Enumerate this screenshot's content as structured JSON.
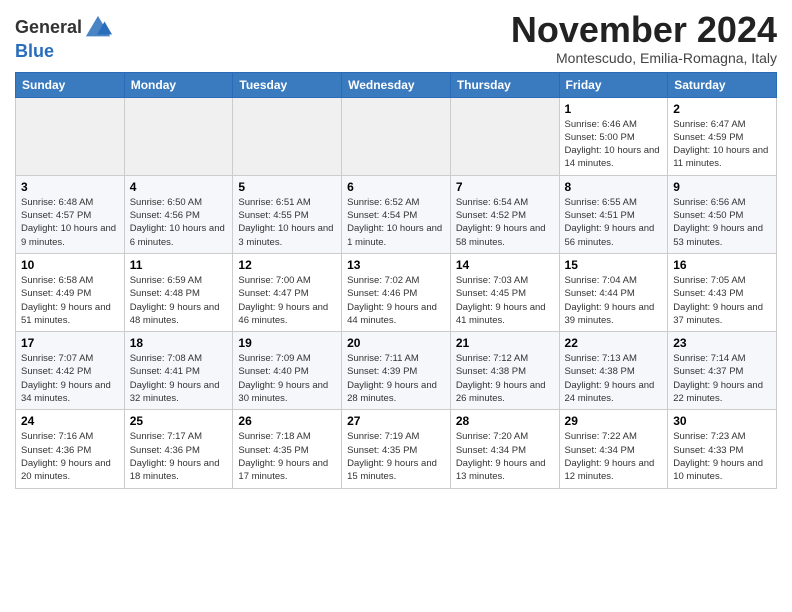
{
  "logo": {
    "general": "General",
    "blue": "Blue"
  },
  "title": "November 2024",
  "subtitle": "Montescudo, Emilia-Romagna, Italy",
  "days_header": [
    "Sunday",
    "Monday",
    "Tuesday",
    "Wednesday",
    "Thursday",
    "Friday",
    "Saturday"
  ],
  "weeks": [
    [
      {
        "day": "",
        "info": ""
      },
      {
        "day": "",
        "info": ""
      },
      {
        "day": "",
        "info": ""
      },
      {
        "day": "",
        "info": ""
      },
      {
        "day": "",
        "info": ""
      },
      {
        "day": "1",
        "info": "Sunrise: 6:46 AM\nSunset: 5:00 PM\nDaylight: 10 hours and 14 minutes."
      },
      {
        "day": "2",
        "info": "Sunrise: 6:47 AM\nSunset: 4:59 PM\nDaylight: 10 hours and 11 minutes."
      }
    ],
    [
      {
        "day": "3",
        "info": "Sunrise: 6:48 AM\nSunset: 4:57 PM\nDaylight: 10 hours and 9 minutes."
      },
      {
        "day": "4",
        "info": "Sunrise: 6:50 AM\nSunset: 4:56 PM\nDaylight: 10 hours and 6 minutes."
      },
      {
        "day": "5",
        "info": "Sunrise: 6:51 AM\nSunset: 4:55 PM\nDaylight: 10 hours and 3 minutes."
      },
      {
        "day": "6",
        "info": "Sunrise: 6:52 AM\nSunset: 4:54 PM\nDaylight: 10 hours and 1 minute."
      },
      {
        "day": "7",
        "info": "Sunrise: 6:54 AM\nSunset: 4:52 PM\nDaylight: 9 hours and 58 minutes."
      },
      {
        "day": "8",
        "info": "Sunrise: 6:55 AM\nSunset: 4:51 PM\nDaylight: 9 hours and 56 minutes."
      },
      {
        "day": "9",
        "info": "Sunrise: 6:56 AM\nSunset: 4:50 PM\nDaylight: 9 hours and 53 minutes."
      }
    ],
    [
      {
        "day": "10",
        "info": "Sunrise: 6:58 AM\nSunset: 4:49 PM\nDaylight: 9 hours and 51 minutes."
      },
      {
        "day": "11",
        "info": "Sunrise: 6:59 AM\nSunset: 4:48 PM\nDaylight: 9 hours and 48 minutes."
      },
      {
        "day": "12",
        "info": "Sunrise: 7:00 AM\nSunset: 4:47 PM\nDaylight: 9 hours and 46 minutes."
      },
      {
        "day": "13",
        "info": "Sunrise: 7:02 AM\nSunset: 4:46 PM\nDaylight: 9 hours and 44 minutes."
      },
      {
        "day": "14",
        "info": "Sunrise: 7:03 AM\nSunset: 4:45 PM\nDaylight: 9 hours and 41 minutes."
      },
      {
        "day": "15",
        "info": "Sunrise: 7:04 AM\nSunset: 4:44 PM\nDaylight: 9 hours and 39 minutes."
      },
      {
        "day": "16",
        "info": "Sunrise: 7:05 AM\nSunset: 4:43 PM\nDaylight: 9 hours and 37 minutes."
      }
    ],
    [
      {
        "day": "17",
        "info": "Sunrise: 7:07 AM\nSunset: 4:42 PM\nDaylight: 9 hours and 34 minutes."
      },
      {
        "day": "18",
        "info": "Sunrise: 7:08 AM\nSunset: 4:41 PM\nDaylight: 9 hours and 32 minutes."
      },
      {
        "day": "19",
        "info": "Sunrise: 7:09 AM\nSunset: 4:40 PM\nDaylight: 9 hours and 30 minutes."
      },
      {
        "day": "20",
        "info": "Sunrise: 7:11 AM\nSunset: 4:39 PM\nDaylight: 9 hours and 28 minutes."
      },
      {
        "day": "21",
        "info": "Sunrise: 7:12 AM\nSunset: 4:38 PM\nDaylight: 9 hours and 26 minutes."
      },
      {
        "day": "22",
        "info": "Sunrise: 7:13 AM\nSunset: 4:38 PM\nDaylight: 9 hours and 24 minutes."
      },
      {
        "day": "23",
        "info": "Sunrise: 7:14 AM\nSunset: 4:37 PM\nDaylight: 9 hours and 22 minutes."
      }
    ],
    [
      {
        "day": "24",
        "info": "Sunrise: 7:16 AM\nSunset: 4:36 PM\nDaylight: 9 hours and 20 minutes."
      },
      {
        "day": "25",
        "info": "Sunrise: 7:17 AM\nSunset: 4:36 PM\nDaylight: 9 hours and 18 minutes."
      },
      {
        "day": "26",
        "info": "Sunrise: 7:18 AM\nSunset: 4:35 PM\nDaylight: 9 hours and 17 minutes."
      },
      {
        "day": "27",
        "info": "Sunrise: 7:19 AM\nSunset: 4:35 PM\nDaylight: 9 hours and 15 minutes."
      },
      {
        "day": "28",
        "info": "Sunrise: 7:20 AM\nSunset: 4:34 PM\nDaylight: 9 hours and 13 minutes."
      },
      {
        "day": "29",
        "info": "Sunrise: 7:22 AM\nSunset: 4:34 PM\nDaylight: 9 hours and 12 minutes."
      },
      {
        "day": "30",
        "info": "Sunrise: 7:23 AM\nSunset: 4:33 PM\nDaylight: 9 hours and 10 minutes."
      }
    ]
  ]
}
